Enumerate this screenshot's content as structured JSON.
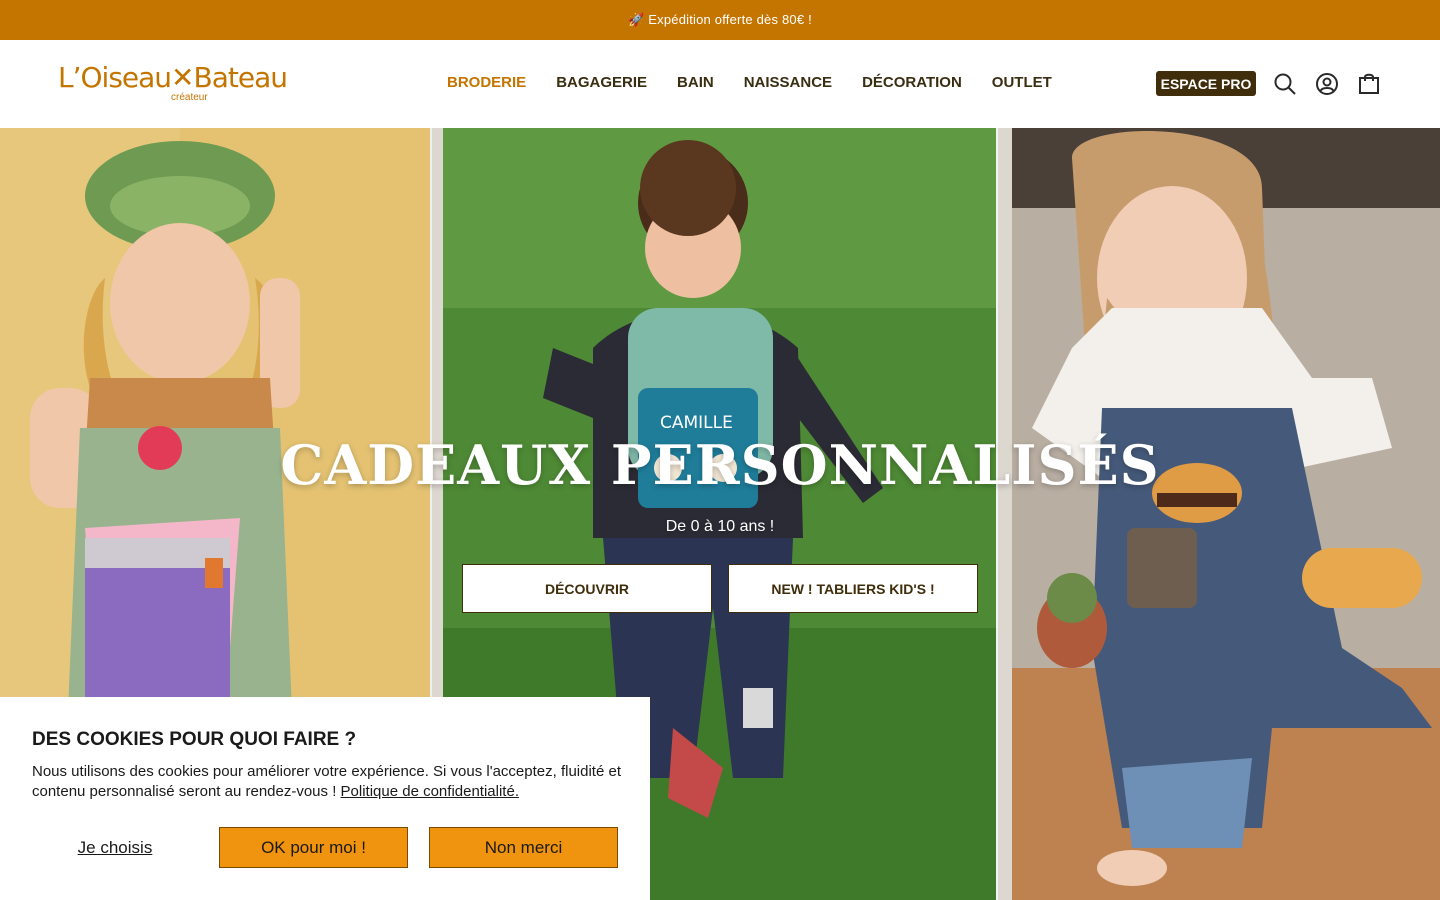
{
  "announcement": {
    "text": "🚀 Expédition offerte dès 80€ !"
  },
  "header": {
    "logo_text": "L’Oiseau✕Bateau",
    "logo_sub": "créateur",
    "nav": [
      {
        "label": "BRODERIE",
        "active": true
      },
      {
        "label": "BAGAGERIE"
      },
      {
        "label": "BAIN"
      },
      {
        "label": "NAISSANCE"
      },
      {
        "label": "DÉCORATION"
      },
      {
        "label": "OUTLET"
      }
    ],
    "pro_label": "ESPACE PRO",
    "icons": [
      "search-icon",
      "account-icon",
      "cart-icon"
    ]
  },
  "hero": {
    "title": "CADEAUX PERSONNALISÉS",
    "subtitle": "De 0 à 10 ans !",
    "buttons": [
      "DÉCOUVRIR",
      "NEW ! TABLIERS KID'S !"
    ],
    "backpack_text": "CAMILLE"
  },
  "cookie": {
    "title": "DES COOKIES POUR QUOI FAIRE ?",
    "text": "Nous utilisons des cookies pour améliorer votre expérience. Si vous l'acceptez, fluidité et contenu personnalisé seront au rendez-vous !",
    "link": "Politique de confidentialité.",
    "choose": "Je choisis",
    "accept": "OK pour moi !",
    "refuse": "Non merci"
  },
  "colors": {
    "accent": "#c47500",
    "brand_dark": "#3f2d0b",
    "cookie_button": "#f0930e"
  }
}
